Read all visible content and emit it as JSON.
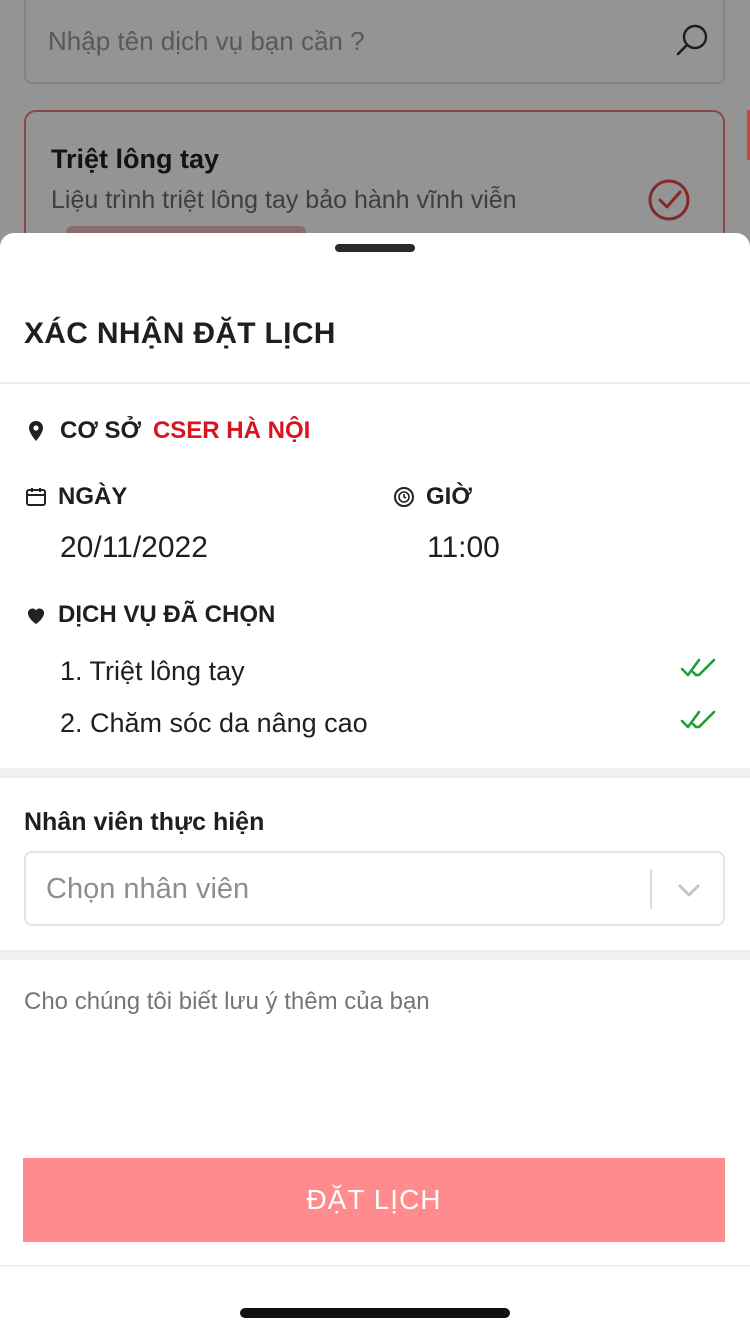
{
  "background": {
    "search_placeholder": "Nhập tên dịch vụ bạn cần ?",
    "card_title": "Triệt lông tay",
    "card_subtitle": "Liệu trình triệt lông tay bảo hành vĩnh viễn"
  },
  "sheet": {
    "title": "XÁC NHẬN ĐẶT LỊCH",
    "location_label": "CƠ SỞ",
    "location_value": "CSER HÀ NỘI",
    "date_label": "NGÀY",
    "date_value": "20/11/2022",
    "time_label": "GIỜ",
    "time_value": "11:00",
    "services_label": "DỊCH VỤ ĐÃ CHỌN",
    "services": [
      {
        "label": "1. Triệt lông tay"
      },
      {
        "label": "2. Chăm sóc da nâng cao"
      }
    ],
    "staff_label": "Nhân viên thực hiện",
    "staff_placeholder": "Chọn nhân viên",
    "note_placeholder": "Cho chúng tôi biết lưu ý thêm của bạn",
    "book_button": "ĐẶT LỊCH"
  },
  "colors": {
    "accent_red": "#d9141e",
    "button_bg": "#ff8b8e",
    "check_green": "#1f9d3a"
  },
  "icons": [
    "search-icon",
    "check-circle-icon",
    "location-pin-icon",
    "calendar-icon",
    "clock-icon",
    "heart-icon",
    "double-check-icon",
    "chevron-down-icon"
  ]
}
